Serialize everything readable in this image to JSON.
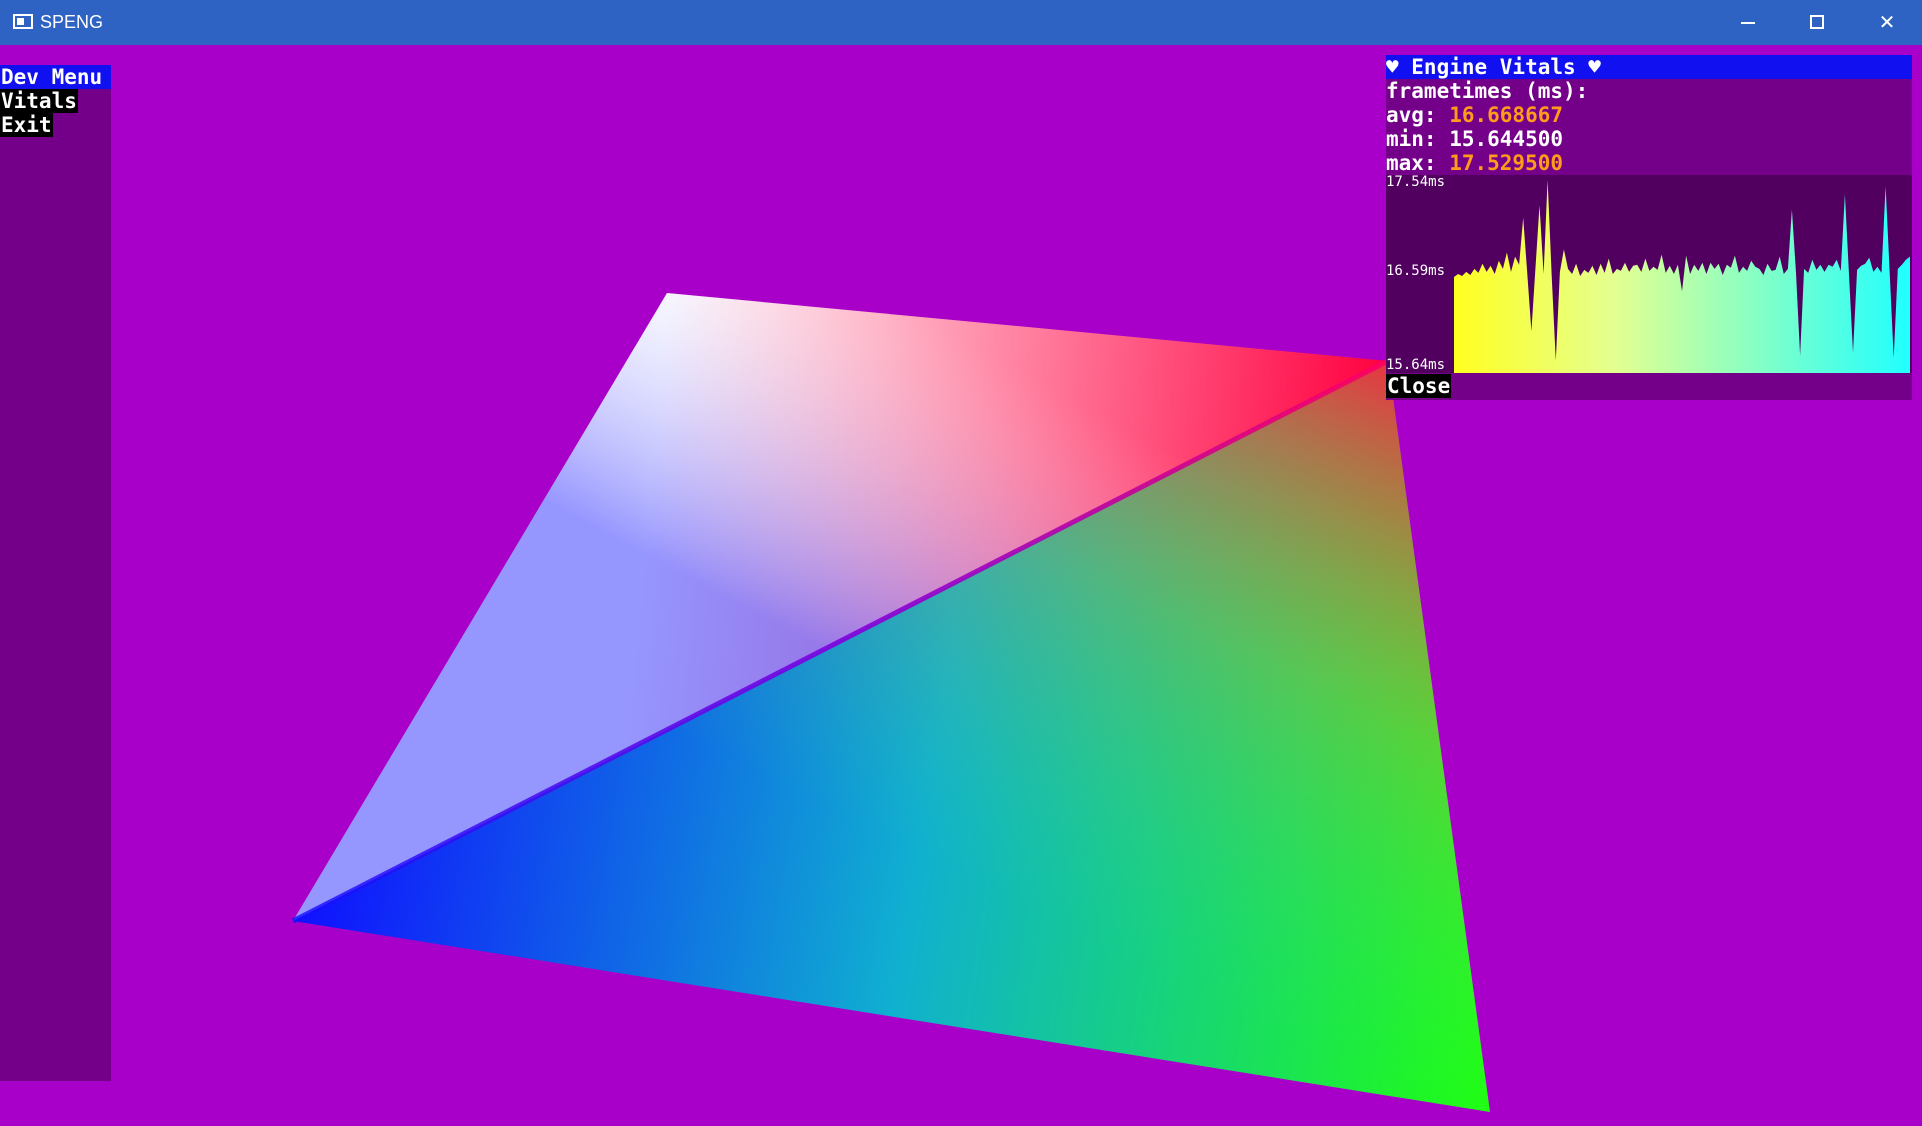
{
  "window": {
    "title": "SPENG",
    "minimize_glyph": "",
    "maximize_glyph": "",
    "close_glyph": "✕"
  },
  "colors": {
    "title_bar": "#2f63c3",
    "background": "#a800c8",
    "panel": "#74008a",
    "highlight": "#1010f0",
    "value_orange": "#ff9a1a",
    "graph_bg": "#520060"
  },
  "dev_menu": {
    "title": "Dev Menu",
    "items": [
      "Vitals",
      "Exit"
    ]
  },
  "vitals": {
    "title": "♥ Engine Vitals ♥",
    "frametimes_label": "frametimes (ms):",
    "avg_label": "avg: ",
    "avg_value": "16.668667",
    "min_label": "min: ",
    "min_value": "15.644500",
    "max_label": "max: ",
    "max_value": "17.529500",
    "close_label": "Close"
  },
  "chart_data": {
    "type": "area",
    "title": "",
    "ylim": [
      15.64,
      17.54
    ],
    "yticks": [
      "17.54ms",
      "16.59ms",
      "15.64ms"
    ],
    "values": [
      16.58,
      16.61,
      16.59,
      16.63,
      16.6,
      16.66,
      16.62,
      16.71,
      16.63,
      16.69,
      16.61,
      16.74,
      16.66,
      16.82,
      16.63,
      16.78,
      16.7,
      17.16,
      16.61,
      16.05,
      16.66,
      17.28,
      16.61,
      17.53,
      16.59,
      15.76,
      16.63,
      16.85,
      16.66,
      16.61,
      16.71,
      16.59,
      16.65,
      16.62,
      16.69,
      16.6,
      16.71,
      16.62,
      16.76,
      16.61,
      16.66,
      16.64,
      16.72,
      16.63,
      16.69,
      16.7,
      16.63,
      16.76,
      16.64,
      16.68,
      16.65,
      16.8,
      16.62,
      16.69,
      16.61,
      16.7,
      16.44,
      16.79,
      16.61,
      16.7,
      16.64,
      16.72,
      16.61,
      16.72,
      16.66,
      16.71,
      16.6,
      16.7,
      16.67,
      16.79,
      16.62,
      16.68,
      16.64,
      16.74,
      16.68,
      16.66,
      16.6,
      16.71,
      16.64,
      16.65,
      16.78,
      16.61,
      16.66,
      17.24,
      16.62,
      15.81,
      16.66,
      16.62,
      16.75,
      16.65,
      16.7,
      16.63,
      16.7,
      16.68,
      16.75,
      16.64,
      17.39,
      16.62,
      15.84,
      16.65,
      16.69,
      16.71,
      16.77,
      16.63,
      16.68,
      16.62,
      17.47,
      16.64,
      15.79,
      16.66,
      16.7,
      16.75,
      16.78
    ]
  }
}
